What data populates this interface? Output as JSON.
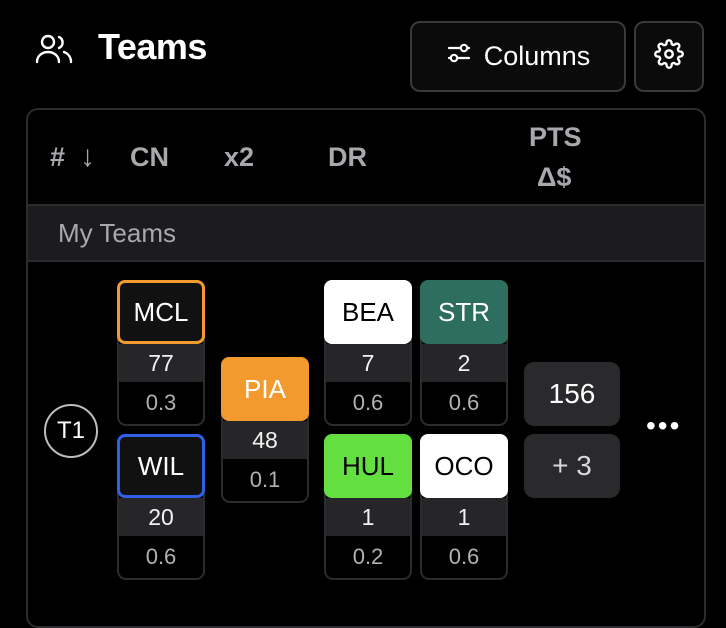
{
  "header": {
    "title": "Teams",
    "columns_label": "Columns"
  },
  "table": {
    "headers": {
      "rank": "#",
      "sort_arrow": "↓",
      "cn": "CN",
      "x2": "x2",
      "dr": "DR",
      "pts": "PTS",
      "delta": "Δ$"
    },
    "section_label": "My Teams",
    "row": {
      "badge": "T1",
      "constructors": [
        {
          "code": "MCL",
          "points": "77",
          "delta": "0.3",
          "color": "#f29a2e",
          "border": "#f29a2e",
          "fill": "#111111"
        },
        {
          "code": "WIL",
          "points": "20",
          "delta": "0.6",
          "color": "#2f60e6",
          "border": "#2f60e6",
          "fill": "#111111"
        }
      ],
      "x2_driver": {
        "code": "PIA",
        "points": "48",
        "delta": "0.1",
        "color": "#f29a2e"
      },
      "drivers": [
        {
          "code": "BEA",
          "points": "7",
          "delta": "0.6",
          "color": "#ffffff",
          "text": "#000000"
        },
        {
          "code": "STR",
          "points": "2",
          "delta": "0.6",
          "color": "#2d6e5e",
          "text": "#ffffff"
        },
        {
          "code": "HUL",
          "points": "1",
          "delta": "0.2",
          "color": "#63e03f",
          "text": "#000000"
        },
        {
          "code": "OCO",
          "points": "1",
          "delta": "0.6",
          "color": "#ffffff",
          "text": "#000000"
        }
      ],
      "total_points": "156",
      "total_delta": "+ 3",
      "more": "•••"
    }
  }
}
